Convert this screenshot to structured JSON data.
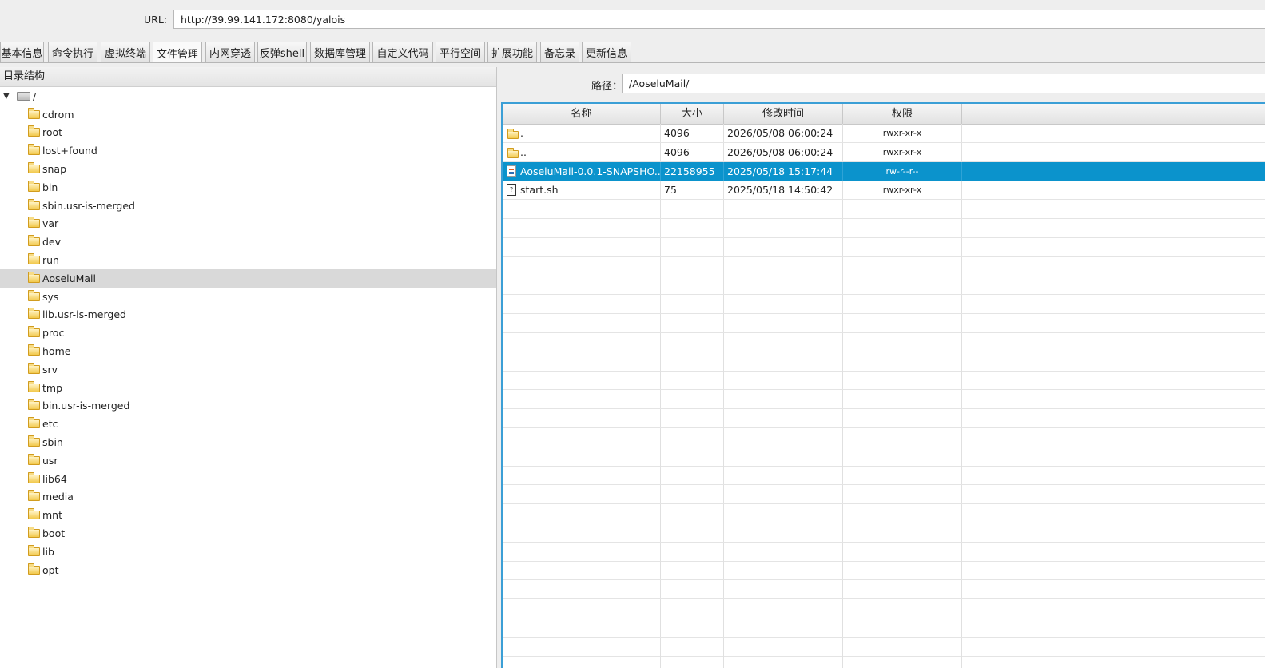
{
  "url_bar": {
    "label": "URL:",
    "value": "http://39.99.141.172:8080/yalois"
  },
  "tabs": [
    {
      "label": "基本信息"
    },
    {
      "label": "命令执行"
    },
    {
      "label": "虚拟终端"
    },
    {
      "label": "文件管理",
      "active": true
    },
    {
      "label": "内网穿透"
    },
    {
      "label": "反弹shell"
    },
    {
      "label": "数据库管理"
    },
    {
      "label": "自定义代码"
    },
    {
      "label": "平行空间"
    },
    {
      "label": "扩展功能"
    },
    {
      "label": "备忘录"
    },
    {
      "label": "更新信息"
    }
  ],
  "tree": {
    "header": "目录结构",
    "root_label": "/",
    "items": [
      "cdrom",
      "root",
      "lost+found",
      "snap",
      "bin",
      "sbin.usr-is-merged",
      "var",
      "dev",
      "run",
      "AoseluMail",
      "sys",
      "lib.usr-is-merged",
      "proc",
      "home",
      "srv",
      "tmp",
      "bin.usr-is-merged",
      "etc",
      "sbin",
      "usr",
      "lib64",
      "media",
      "mnt",
      "boot",
      "lib",
      "opt"
    ],
    "selected": "AoseluMail"
  },
  "path_bar": {
    "label": "路径：",
    "value": "/AoseluMail/"
  },
  "file_table": {
    "columns": [
      "名称",
      "大小",
      "修改时间",
      "权限"
    ],
    "rows": [
      {
        "name": ".",
        "size": "4096",
        "modified": "2026/05/08 06:00:24",
        "perm": "rwxr-xr-x",
        "icon": "folder-icon"
      },
      {
        "name": "..",
        "size": "4096",
        "modified": "2026/05/08 06:00:24",
        "perm": "rwxr-xr-x",
        "icon": "folder-icon"
      },
      {
        "name": "AoseluMail-0.0.1-SNAPSHO...",
        "size": "22158955",
        "modified": "2025/05/18 15:17:44",
        "perm": "rw-r--r--",
        "icon": "jar-file-icon",
        "selected": true
      },
      {
        "name": "start.sh",
        "size": "75",
        "modified": "2025/05/18 14:50:42",
        "perm": "rwxr-xr-x",
        "icon": "script-file-icon"
      }
    ]
  }
}
